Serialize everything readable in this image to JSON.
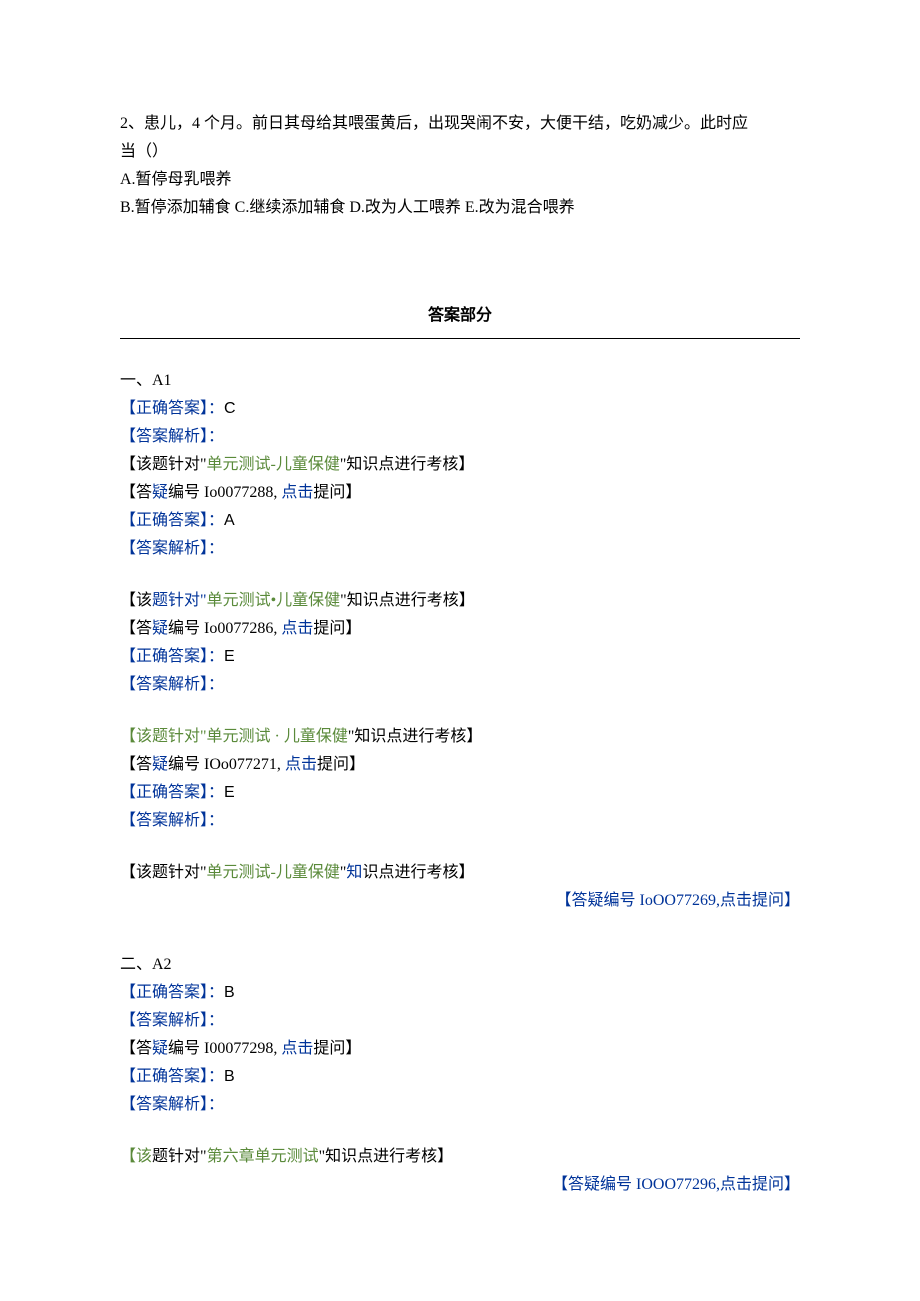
{
  "question": {
    "stem_line1": "2、患儿，4 个月。前日其母给其喂蛋黄后，出现哭闹不安，大便干结，吃奶减少。此时应",
    "stem_line2": "当（）",
    "optA": "A.暂停母乳喂养",
    "opt_rest": "B.暂停添加辅食 C.继续添加辅食 D.改为人工喂养 E.改为混合喂养"
  },
  "answer_header": "答案部分",
  "labels": {
    "correct_answer_prefix": "【正确答案】：",
    "analysis_label": "【答案解析】：",
    "topic_prefix_black": "【该题针对\"",
    "topic_prefix_green_full": "【该题针对\"",
    "topic_l_open": "【该",
    "topic_suffix": "\"知识点进行考核】",
    "faq_prefix": "【答",
    "faq_mid": "编号 ",
    "faq_mid_nospace": "编号",
    "click": "点击",
    "ask_close": "提问】"
  },
  "s1": {
    "heading": "一、A1",
    "a1_ans": "C",
    "a2_topic": "单元测试-儿童保健",
    "a2_faq_id": "Io0077288, ",
    "a2_ans": "A",
    "a3_topic": "单元测试•儿童保健",
    "a3_faq_id": "Io0077286, ",
    "a3_ans": "E",
    "a4_topic": "单元测试 · 儿童保健",
    "a4_faq_id": "IOo077271, ",
    "a4_ans": "E",
    "a5_topic": "单元测试-儿童保健",
    "a5_faq_right": "【答疑编号 IoOO77269,点击提问】"
  },
  "s2": {
    "heading": "二、A2",
    "b1_ans": "B",
    "b2_faq_id": "I00077298, ",
    "b2_ans": "B",
    "b3_topic": "第六章单元测试",
    "b3_faq_right": "【答疑编号 IOOO77296,点击提问】"
  }
}
